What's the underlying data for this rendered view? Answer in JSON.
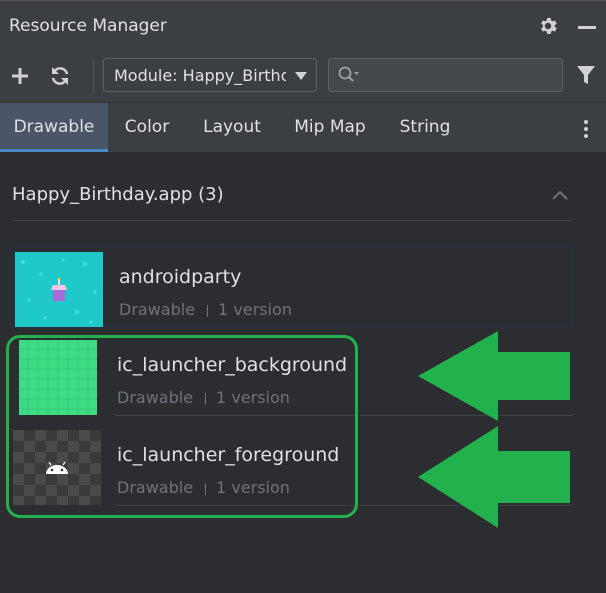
{
  "window": {
    "title": "Resource Manager"
  },
  "toolbar": {
    "add_icon": "plus-icon",
    "refresh_icon": "refresh-icon",
    "module_select": "Module: Happy_Birthday",
    "search_placeholder": "",
    "filter_icon": "filter-icon"
  },
  "tabs": [
    {
      "label": "Drawable",
      "active": true
    },
    {
      "label": "Color"
    },
    {
      "label": "Layout"
    },
    {
      "label": "Mip Map"
    },
    {
      "label": "String"
    }
  ],
  "section": {
    "title": "Happy_Birthday.app (3)"
  },
  "resources": [
    {
      "name": "androidparty",
      "type": "Drawable",
      "versions": "1 version"
    },
    {
      "name": "ic_launcher_background",
      "type": "Drawable",
      "versions": "1 version"
    },
    {
      "name": "ic_launcher_foreground",
      "type": "Drawable",
      "versions": "1 version"
    }
  ],
  "colors": {
    "accent": "#4a88c7",
    "annotation": "#22b14c",
    "background": "#2b2d30"
  }
}
